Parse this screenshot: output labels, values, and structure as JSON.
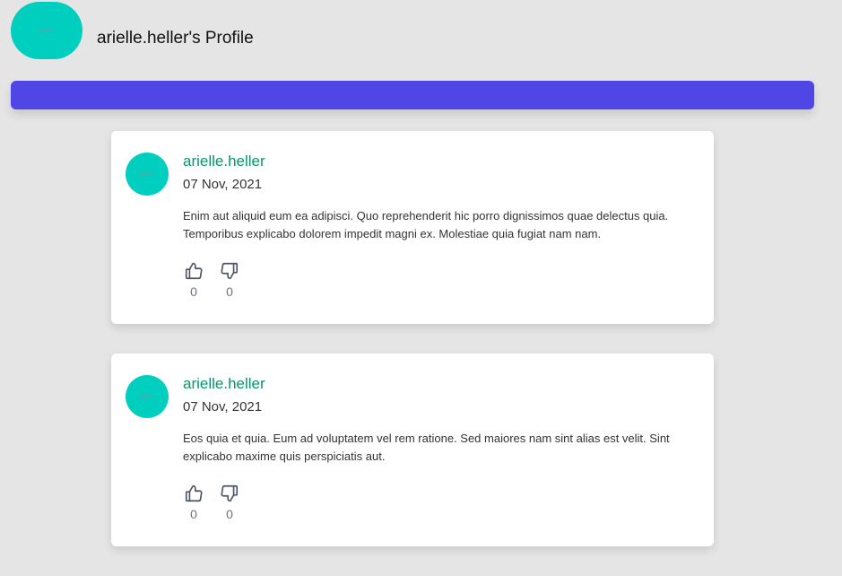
{
  "profile": {
    "title": "arielle.heller's Profile",
    "avatar_alt": "avatar"
  },
  "banner": {
    "color": "#4f46e5"
  },
  "posts": [
    {
      "author": "arielle.heller",
      "avatar_alt": "avatar",
      "date": "07 Nov, 2021",
      "body": "Enim aut aliquid eum ea adipisci. Quo reprehenderit hic porro dignissimos quae delectus quia. Temporibus explicabo dolorem impedit magni ex. Molestiae quia fugiat nam nam.",
      "likes": "0",
      "dislikes": "0"
    },
    {
      "author": "arielle.heller",
      "avatar_alt": "avatar",
      "date": "07 Nov, 2021",
      "body": "Eos quia et quia. Eum ad voluptatem vel rem ratione. Sed maiores nam sint alias est velit. Sint explicabo maxime quis perspiciatis aut.",
      "likes": "0",
      "dislikes": "0"
    }
  ],
  "icons": {
    "like": "thumbs-up-icon",
    "dislike": "thumbs-down-icon"
  },
  "colors": {
    "avatar": "#00cfc0",
    "author_link": "#059669",
    "background": "#e5e5e5"
  }
}
